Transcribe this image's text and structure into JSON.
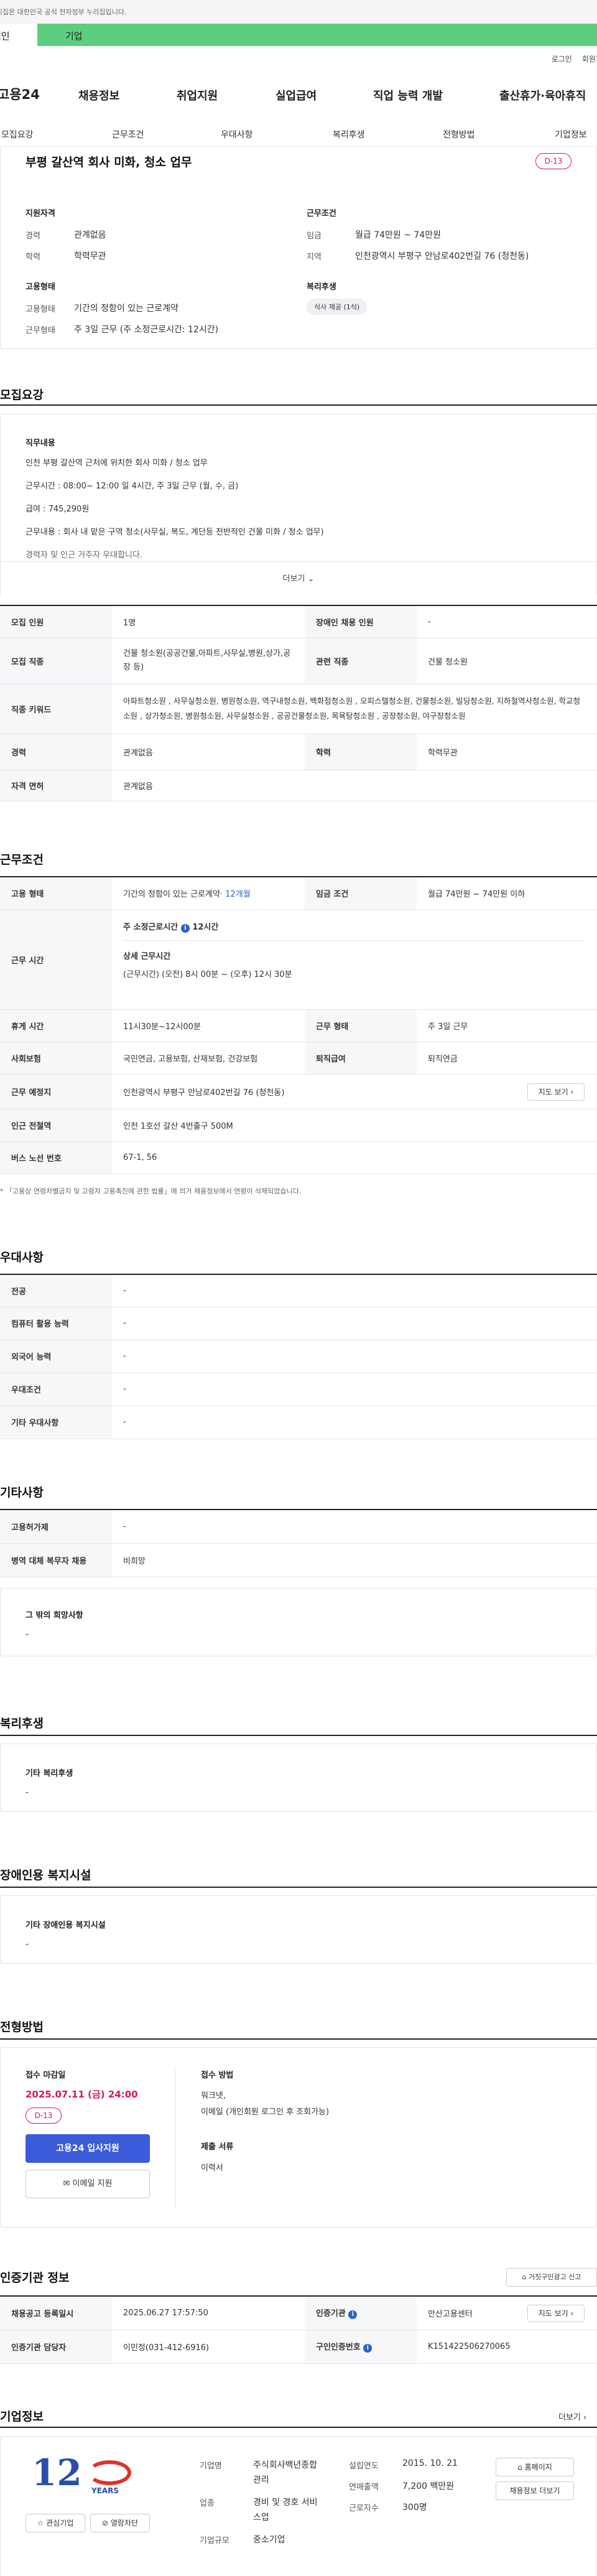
{
  "top": {
    "gov_banner": "이 누리집은 대한민국 공식 전자정부 누리집입니다.",
    "tab_individual": "개인",
    "tab_business": "기업",
    "login": "로그인",
    "signup": "회원가입"
  },
  "header": {
    "logo": "고용24",
    "nav": [
      "채용정보",
      "취업지원",
      "실업급여",
      "직업 능력 개발",
      "출산휴가·육아휴직"
    ]
  },
  "subnav": [
    "모집요강",
    "근무조건",
    "우대사항",
    "복리후생",
    "전형방법",
    "기업정보"
  ],
  "job": {
    "title": "부평 갈산역 회사 미화, 청소 업무",
    "dday": "D-13",
    "qual_title": "지원자격",
    "career_label": "경력",
    "career_value": "관계없음",
    "edu_label": "학력",
    "edu_value": "학력무관",
    "cond_title": "근무조건",
    "wage_label": "임금",
    "wage_value": "월급 74만원 ~ 74만원",
    "region_label": "지역",
    "region_value": "인천광역시 부평구 안남로402번길 76 (청천동)",
    "emp_title": "고용형태",
    "emp_label": "고용형태",
    "emp_value": "기간의 정함이 있는 근로계약",
    "worktype_label": "근무형태",
    "worktype_value": "주 3일 근무 (주 소정근로시간: 12시간)",
    "welfare_title": "복리후생",
    "welfare_badge": "식사 제공 (1식)"
  },
  "recruit": {
    "title": "모집요강",
    "duty_label": "직무내용",
    "lines": [
      "인천 부평 갈산역 근처에 위치한 회사 미화 / 청소 업무",
      "근무시간 : 08:00~ 12:00 일 4시간, 주 3일 근무 (월, 수, 금)",
      "급여 : 745,290원",
      "근무내용 : 회사 내 맡은 구역 청소(사무실, 복도, 계단등 전반적인 건물 미화 / 청소 업무)",
      "경력자 및 인근 거주자 우대합니다."
    ],
    "more": "더보기",
    "r1_h1": "모집 인원",
    "r1_v1": "1명",
    "r1_h2": "장애인 채용 인원",
    "r1_v2": "-",
    "r2_h1": "모집 직종",
    "r2_v1": "건물 청소원(공공건물,아파트,사무실,병원,상가,공장 등)",
    "r2_h2": "관련 직종",
    "r2_v2": "건물 청소원",
    "r3_h1": "직종 키워드",
    "r3_v1": "아파트청소원 , 사무실청소원, 병원청소원, 역구내청소원, 백화점청소원 , 오피스텔청소원, 건물청소원, 빌딩청소원, 지하철역사청소원, 학교청소원 , 상가청소원, 병원청소원, 사무실청소원 , 공공건물청소원, 목욕탕청소원 , 공장청소원, 야구장청소원",
    "r4_h1": "경력",
    "r4_v1": "관계없음",
    "r4_h2": "학력",
    "r4_v2": "학력무관",
    "r5_h1": "자격 면허",
    "r5_v1": "관계없음"
  },
  "conditions": {
    "title": "근무조건",
    "emp_h": "고용 형태",
    "emp_v": "기간의 정함이 있는 근로계약",
    "emp_v_extra": "· 12개월",
    "wage_h": "임금 조건",
    "wage_v": "월급 74만원 ~ 74만원 이하",
    "hours_h": "근무 시간",
    "weekly_label": "주 소정근로시간",
    "weekly_value": "12시간",
    "detail_label": "상세 근무시간",
    "detail_value": "(근무시간) (오전) 8시 00분 ~ (오후) 12시 30분",
    "break_h": "휴게 시간",
    "break_v": "11시30분~12시00분",
    "shift_h": "근무 형태",
    "shift_v": "주 3일 근무",
    "ins_h": "사회보험",
    "ins_v": "국민연금, 고용보험, 산재보험, 건강보험",
    "sev_h": "퇴직급여",
    "sev_v": "퇴직연금",
    "place_h": "근무 예정지",
    "place_v": "인천광역시 부평구 안남로402번길 76 (청천동)",
    "map_btn": "지도 보기",
    "subway_h": "인근 전철역",
    "subway_v": "인천 1호선 갈산 4번출구 500M",
    "bus_h": "버스 노선 번호",
    "bus_v": "67-1, 56",
    "note": "* 「고용상 연령차별금지 및 고령자 고용촉진에 관한 법률」에 의거 채용정보에서 연령이 삭제되었습니다."
  },
  "prefer": {
    "title": "우대사항",
    "rows": [
      {
        "h": "전공",
        "v": "-"
      },
      {
        "h": "컴퓨터 활용 능력",
        "v": "-"
      },
      {
        "h": "외국어 능력",
        "v": "-"
      },
      {
        "h": "우대조건",
        "v": "-"
      },
      {
        "h": "기타 우대사항",
        "v": "-"
      }
    ]
  },
  "etc": {
    "title": "기타사항",
    "rows": [
      {
        "h": "고용허가제",
        "v": "-"
      },
      {
        "h": "병역 대체 복무자 채용",
        "v": "비희망"
      }
    ],
    "hope_label": "그 밖의 희망사항",
    "hope_value": "-"
  },
  "welfare": {
    "title": "복리후생",
    "label": "기타 복리후생",
    "value": "-"
  },
  "disabled": {
    "title": "장애인용 복지시설",
    "label": "기타 장애인용 복지시설",
    "value": "-"
  },
  "process": {
    "title": "전형방법",
    "deadline_label": "접수 마감일",
    "deadline_value": "2025.07.11 (금) 24:00",
    "dday": "D-13",
    "apply_btn": "고용24 입사지원",
    "email_btn": "이메일 지원",
    "method_label": "접수 방법",
    "method_value1": "워크넷,",
    "method_value2": "이메일 (개인회원 로그인 후 조회가능)",
    "docs_label": "제출 서류",
    "docs_value": "이력서"
  },
  "cert": {
    "title": "인증기관 정보",
    "report_btn": "거짓구인광고 신고",
    "reg_h": "채용공고 등록일시",
    "reg_v": "2025.06.27 17:57:50",
    "org_h": "인증기관",
    "org_v": "안산고용센터",
    "map_btn": "지도 보기",
    "mgr_h": "인증기관 담당자",
    "mgr_v": "이민정(031-412-6916)",
    "no_h": "구인인증번호",
    "no_v": "K151422506270065"
  },
  "company": {
    "title": "기업정보",
    "more": "더보기",
    "logo_text": "YEARS",
    "logo_num": "12",
    "fav_btn": "관심기업",
    "block_btn": "열람차단",
    "homepage_btn": "홈페이지",
    "jobs_btn": "채용정보 더보기",
    "name_label": "기업명",
    "name_value1": "주식회사백년종합",
    "name_value2": "관리",
    "industry_label": "업종",
    "industry_value1": "경비 및 경호 서비",
    "industry_value2": "스업",
    "size_label": "기업규모",
    "size_value": "중소기업",
    "founded_label": "설립연도",
    "founded_value": "2015. 10. 21",
    "sales_label": "연매출액",
    "sales_value": "7,200 백만원",
    "staff_label": "근로자수",
    "staff_value": "300명"
  }
}
